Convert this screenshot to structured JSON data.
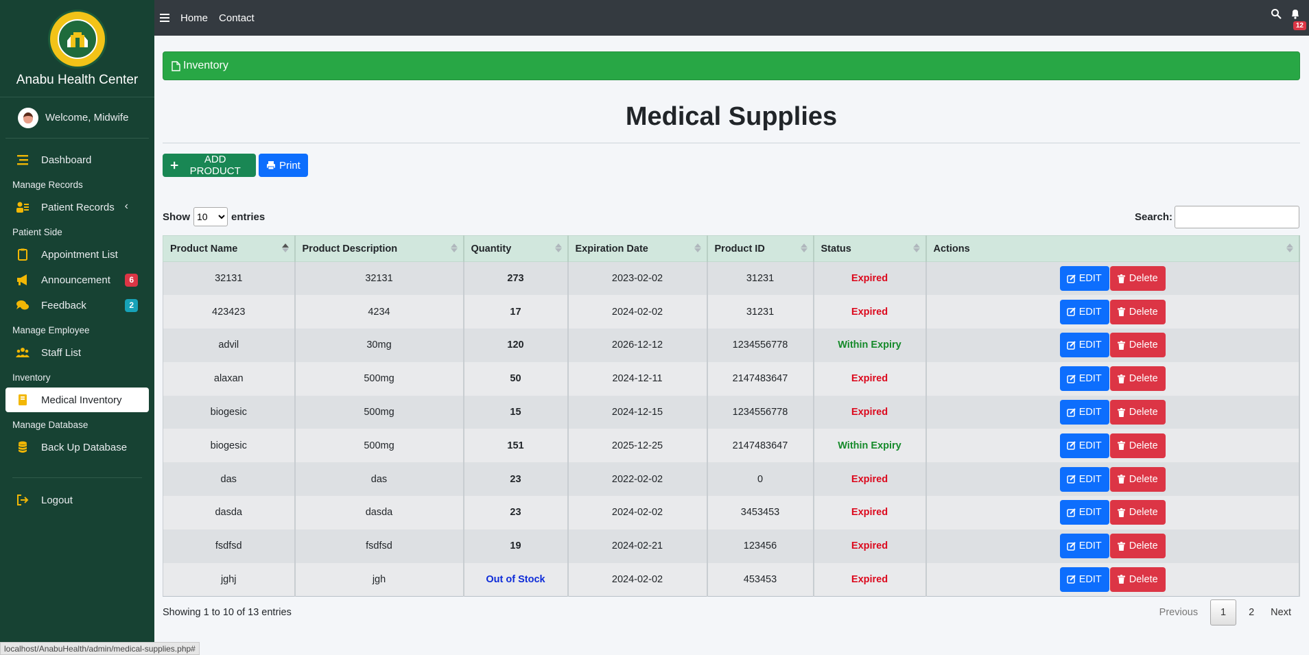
{
  "brand": {
    "logo_text": "ANABU II F HEALTH CENTER",
    "name": "Anabu Health Center"
  },
  "user": {
    "welcome": "Welcome, Midwife"
  },
  "sidebar": {
    "dashboard": "Dashboard",
    "manage_records": "Manage Records",
    "patient_records": "Patient Records",
    "patient_side": "Patient Side",
    "appointment_list": "Appointment List",
    "announcement": "Announcement",
    "announcement_badge": "6",
    "feedback": "Feedback",
    "feedback_badge": "2",
    "manage_employee": "Manage Employee",
    "staff_list": "Staff List",
    "inventory": "Inventory",
    "medical_inventory": "Medical Inventory",
    "manage_database": "Manage Database",
    "backup_database": "Back Up Database",
    "logout": "Logout"
  },
  "topbar": {
    "home": "Home",
    "contact": "Contact",
    "notif_count": "12"
  },
  "content": {
    "card_title": "Inventory",
    "page_title": "Medical Supplies",
    "add_product": "ADD PRODUCT",
    "print": "Print",
    "show_label": "Show",
    "entries_label": "entries",
    "length_value": "10",
    "search_label": "Search:",
    "search_value": ""
  },
  "table": {
    "headers": [
      "Product Name",
      "Product Description",
      "Quantity",
      "Expiration Date",
      "Product ID",
      "Status",
      "Actions"
    ],
    "edit_label": "EDIT",
    "delete_label": "Delete",
    "rows": [
      {
        "name": "32131",
        "desc": "32131",
        "qty": "273",
        "exp": "2023-02-02",
        "pid": "31231",
        "status": "Expired"
      },
      {
        "name": "423423",
        "desc": "4234",
        "qty": "17",
        "exp": "2024-02-02",
        "pid": "31231",
        "status": "Expired"
      },
      {
        "name": "advil",
        "desc": "30mg",
        "qty": "120",
        "exp": "2026-12-12",
        "pid": "1234556778",
        "status": "Within Expiry"
      },
      {
        "name": "alaxan",
        "desc": "500mg",
        "qty": "50",
        "exp": "2024-12-11",
        "pid": "2147483647",
        "status": "Expired"
      },
      {
        "name": "biogesic",
        "desc": "500mg",
        "qty": "15",
        "exp": "2024-12-15",
        "pid": "1234556778",
        "status": "Expired"
      },
      {
        "name": "biogesic",
        "desc": "500mg",
        "qty": "151",
        "exp": "2025-12-25",
        "pid": "2147483647",
        "status": "Within Expiry"
      },
      {
        "name": "das",
        "desc": "das",
        "qty": "23",
        "exp": "2022-02-02",
        "pid": "0",
        "status": "Expired"
      },
      {
        "name": "dasda",
        "desc": "dasda",
        "qty": "23",
        "exp": "2024-02-02",
        "pid": "3453453",
        "status": "Expired"
      },
      {
        "name": "fsdfsd",
        "desc": "fsdfsd",
        "qty": "19",
        "exp": "2024-02-21",
        "pid": "123456",
        "status": "Expired"
      },
      {
        "name": "jghj",
        "desc": "jgh",
        "qty": "Out of Stock",
        "exp": "2024-02-02",
        "pid": "453453",
        "status": "Expired"
      }
    ]
  },
  "footer": {
    "info": "Showing 1 to 10 of 13 entries",
    "previous": "Previous",
    "page1": "1",
    "page2": "2",
    "next": "Next"
  },
  "statusbar": {
    "url": "localhost/AnabuHealth/admin/medical-supplies.php#"
  },
  "colors": {
    "sidebar": "#174233",
    "accent_yellow": "#f2b705",
    "green": "#28a745",
    "blue": "#0d6efd",
    "red": "#dc3545"
  }
}
